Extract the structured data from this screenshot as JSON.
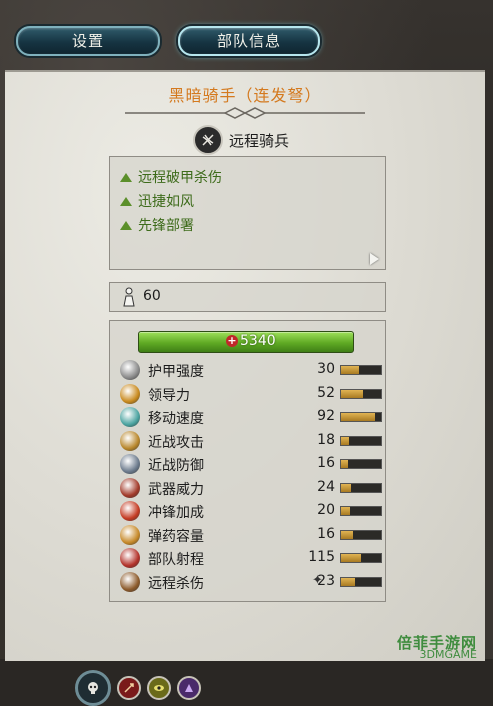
{
  "tabs": [
    {
      "label": "设置",
      "active": false
    },
    {
      "label": "部队信息",
      "active": true
    }
  ],
  "unit": {
    "name": "黑暗骑手（连发弩）",
    "class_label": "远程骑兵",
    "class_icon": "crossbow-icon"
  },
  "abilities": [
    "远程破甲杀伤",
    "迅捷如风",
    "先锋部署"
  ],
  "unit_size": "60",
  "hp": "5340",
  "stats": [
    {
      "label": "护甲强度",
      "value": "30",
      "fill": 0.45,
      "icon": "armor-icon",
      "color": "#8a8a8a"
    },
    {
      "label": "领导力",
      "value": "52",
      "fill": 0.55,
      "icon": "leadership-icon",
      "color": "#c98a1e"
    },
    {
      "label": "移动速度",
      "value": "92",
      "fill": 0.85,
      "icon": "speed-icon",
      "color": "#4aa3a0"
    },
    {
      "label": "近战攻击",
      "value": "18",
      "fill": 0.2,
      "icon": "melee-attack-icon",
      "color": "#b8862a"
    },
    {
      "label": "近战防御",
      "value": "16",
      "fill": 0.18,
      "icon": "melee-defense-icon",
      "color": "#6b7a8c"
    },
    {
      "label": "武器威力",
      "value": "24",
      "fill": 0.25,
      "icon": "weapon-strength-icon",
      "color": "#a23a2a"
    },
    {
      "label": "冲锋加成",
      "value": "20",
      "fill": 0.22,
      "icon": "charge-bonus-icon",
      "color": "#c43a22"
    },
    {
      "label": "弹药容量",
      "value": "16",
      "fill": 0.3,
      "icon": "ammunition-icon",
      "color": "#c78a2a"
    },
    {
      "label": "部队射程",
      "value": "115",
      "fill": 0.5,
      "icon": "range-icon",
      "color": "#b3322a"
    },
    {
      "label": "远程杀伤",
      "value": "23",
      "fill": 0.35,
      "icon": "missile-damage-icon",
      "color": "#8c5a2a"
    }
  ],
  "watermark": "倍菲手游网",
  "watermark_sub": "3DMGAME"
}
